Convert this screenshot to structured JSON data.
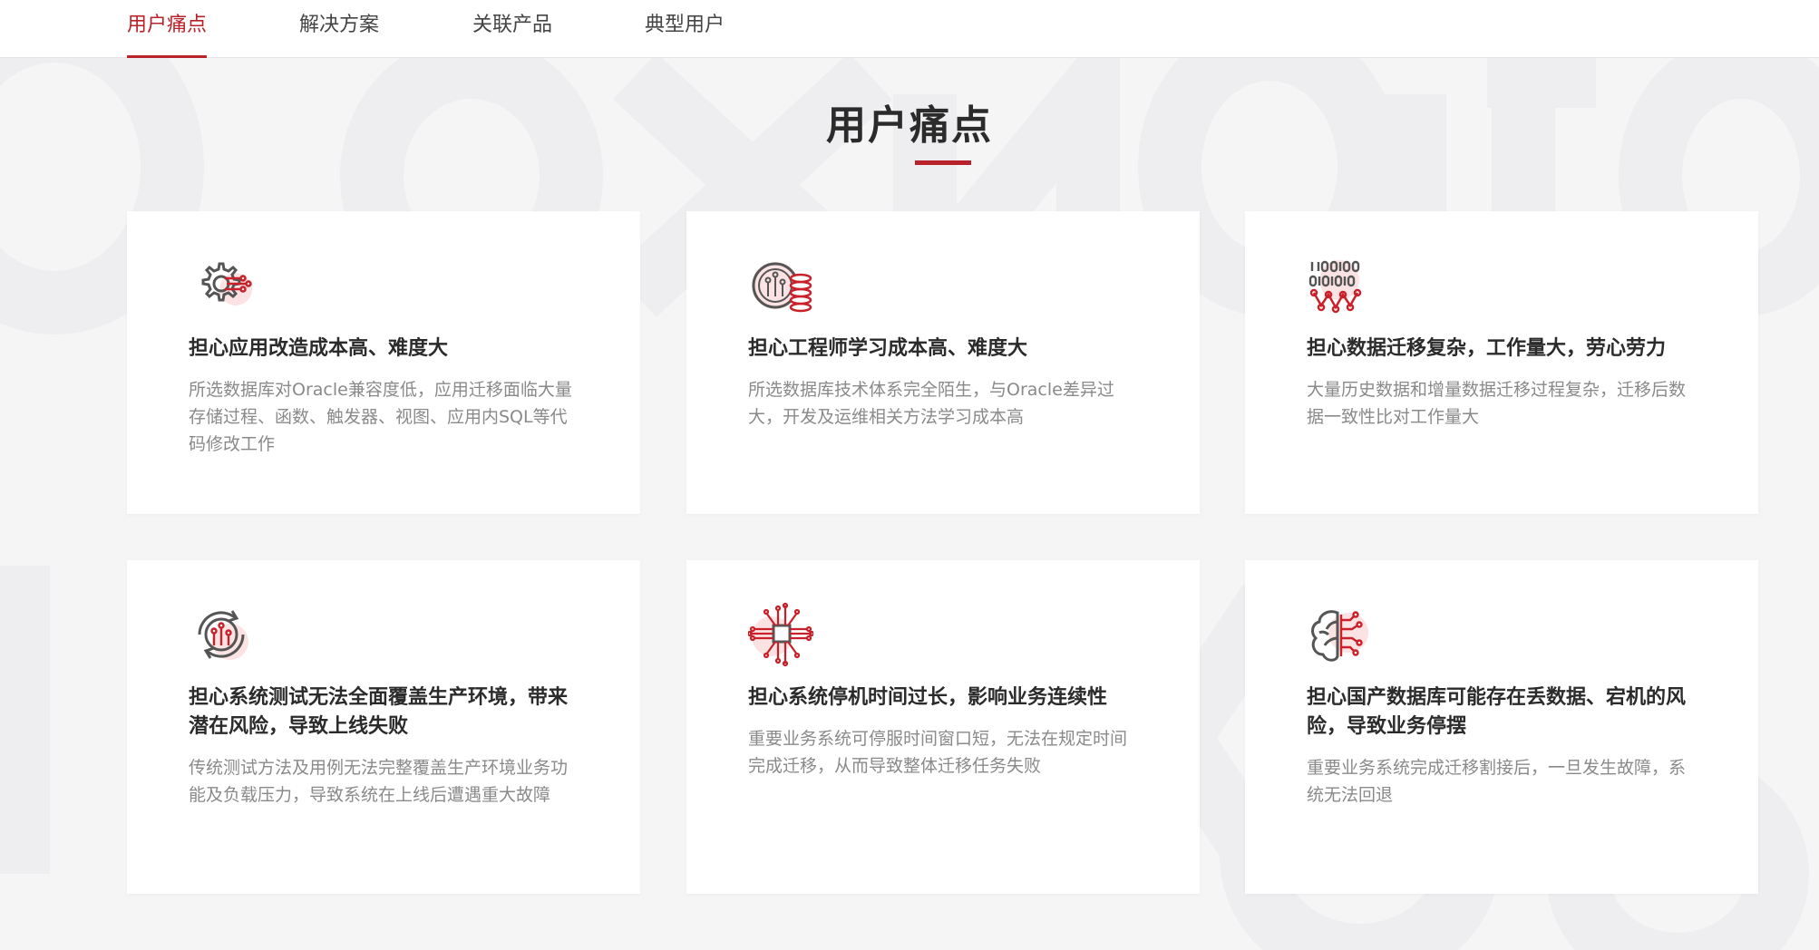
{
  "nav": {
    "tabs": [
      {
        "label": "用户痛点",
        "active": true
      },
      {
        "label": "解决方案",
        "active": false
      },
      {
        "label": "关联产品",
        "active": false
      },
      {
        "label": "典型用户",
        "active": false
      }
    ]
  },
  "section": {
    "title": "用户痛点"
  },
  "colors": {
    "accent": "#b8222a",
    "background": "#f5f5f6",
    "card": "#ffffff",
    "text": "#2b2b2b",
    "muted": "#8a8a8a"
  },
  "cards": [
    {
      "icon": "gear-circuit-icon",
      "title": "担心应用改造成本高、难度大",
      "desc": "所选数据库对Oracle兼容度低，应用迁移面临大量存储过程、函数、触发器、视图、应用内SQL等代码修改工作"
    },
    {
      "icon": "circuit-database-icon",
      "title": "担心工程师学习成本高、难度大",
      "desc": "所选数据库技术体系完全陌生，与Oracle差异过大，开发及运维相关方法学习成本高"
    },
    {
      "icon": "binary-data-icon",
      "title": "担心数据迁移复杂，工作量大，劳心劳力",
      "desc": "大量历史数据和增量数据迁移过程复杂，迁移后数据一致性比对工作量大"
    },
    {
      "icon": "refresh-circuit-icon",
      "title": "担心系统测试无法全面覆盖生产环境，带来潜在风险，导致上线失败",
      "desc": "传统测试方法及用例无法完整覆盖生产环境业务功能及负载压力，导致系统在上线后遭遇重大故障"
    },
    {
      "icon": "chip-circuit-icon",
      "title": "担心系统停机时间过长，影响业务连续性",
      "desc": "重要业务系统可停服时间窗口短，无法在规定时间完成迁移，从而导致整体迁移任务失败"
    },
    {
      "icon": "brain-circuit-icon",
      "title": "担心国产数据库可能存在丢数据、宕机的风险，导致业务停摆",
      "desc": "重要业务系统完成迁移割接后，一旦发生故障，系统无法回退"
    }
  ]
}
